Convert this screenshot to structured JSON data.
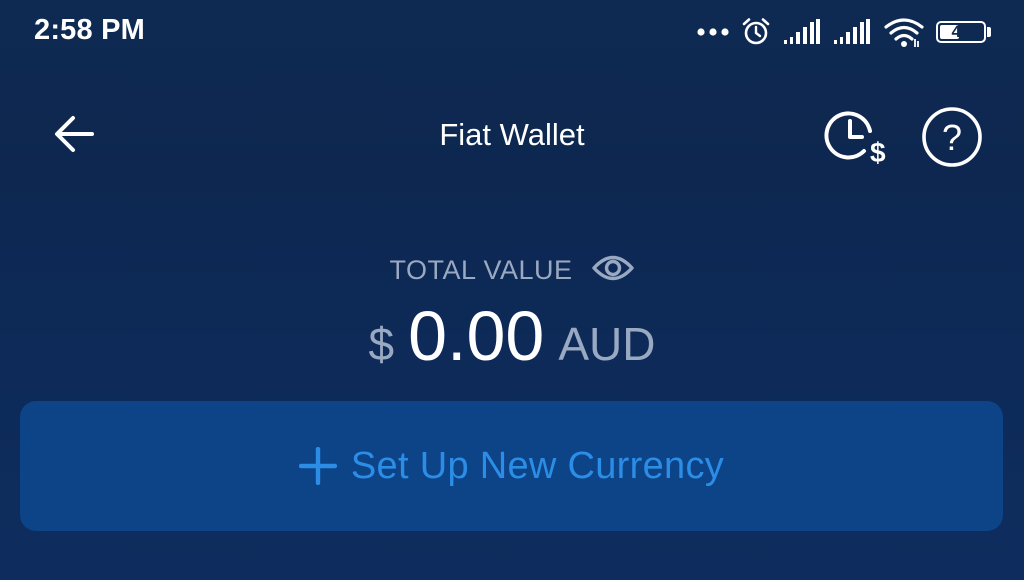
{
  "status_bar": {
    "time": "2:58 PM",
    "battery_level": "42",
    "icons": [
      "more-dots-icon",
      "alarm-clock-icon",
      "signal-icon",
      "signal-icon",
      "wifi-icon",
      "battery-icon"
    ]
  },
  "header": {
    "title": "Fiat Wallet",
    "back_icon": "arrow-left-icon",
    "history_icon": "clock-dollar-icon",
    "help_icon": "question-circle-icon"
  },
  "balance": {
    "label": "TOTAL VALUE",
    "visibility_icon": "eye-icon",
    "currency_symbol": "$",
    "amount": "0.00",
    "currency_code": "AUD"
  },
  "setup": {
    "label": "Set Up New Currency",
    "icon": "plus-icon"
  },
  "colors": {
    "background": "#0f2a52",
    "button_bg": "#0d4387",
    "accent": "#2b8de6",
    "muted_text": "#9aa9c2",
    "text": "#ffffff"
  }
}
